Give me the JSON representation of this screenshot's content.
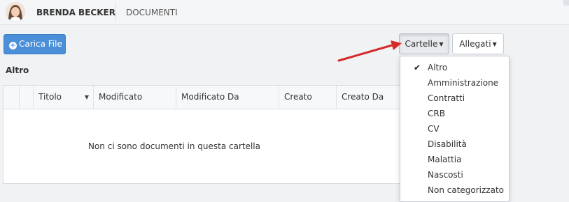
{
  "topbar": {
    "user_name": "BRENDA BECKER",
    "section": "DOCUMENTI"
  },
  "toolbar": {
    "upload_label": "Carica File",
    "folders_label": "Cartelle",
    "attachments_label": "Allegati"
  },
  "current_folder": "Altro",
  "table": {
    "columns": [
      "Titolo",
      "Modificato",
      "Modificato Da",
      "Creato",
      "Creato Da"
    ],
    "empty_message": "Non ci sono documenti in questa cartella"
  },
  "folders_menu": {
    "items": [
      {
        "label": "Altro",
        "checked": true
      },
      {
        "label": "Amministrazione",
        "checked": false
      },
      {
        "label": "Contratti",
        "checked": false
      },
      {
        "label": "CRB",
        "checked": false
      },
      {
        "label": "CV",
        "checked": false
      },
      {
        "label": "Disabilità",
        "checked": false
      },
      {
        "label": "Malattia",
        "checked": false
      },
      {
        "label": "Nascosti",
        "checked": false
      },
      {
        "label": "Non categorizzato",
        "checked": false
      }
    ]
  },
  "colors": {
    "primary_button": "#4a8fd8",
    "annotation_arrow": "#d42a2a"
  },
  "icons": [
    "avatar",
    "plus-circle-icon",
    "caret-down-icon",
    "sort-desc-icon",
    "check-icon"
  ]
}
